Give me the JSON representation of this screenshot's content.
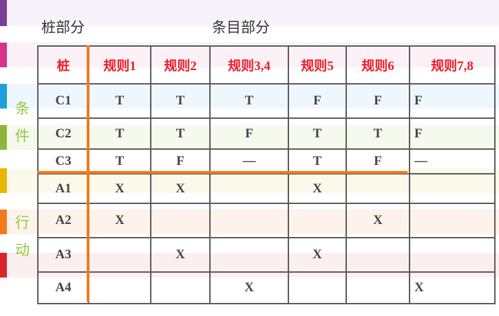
{
  "headers": {
    "stub_part": "桩部分",
    "entry_part": "条目部分"
  },
  "side_labels": {
    "conditions": [
      "条",
      "件"
    ],
    "actions": [
      "行",
      "动"
    ]
  },
  "columns": [
    "桩",
    "规则1",
    "规则2",
    "规则3,4",
    "规则5",
    "规则6",
    "规则7,8"
  ],
  "rows": [
    {
      "label": "C1",
      "cells": [
        "T",
        "T",
        "T",
        "F",
        "F",
        "F"
      ]
    },
    {
      "label": "C2",
      "cells": [
        "T",
        "T",
        "F",
        "T",
        "T",
        "F"
      ]
    },
    {
      "label": "C3",
      "cells": [
        "T",
        "F",
        "—",
        "T",
        "F",
        "—"
      ]
    },
    {
      "label": "A1",
      "cells": [
        "X",
        "X",
        "",
        "X",
        "",
        ""
      ]
    },
    {
      "label": "A2",
      "cells": [
        "X",
        "",
        "",
        "",
        "X",
        ""
      ]
    },
    {
      "label": "A3",
      "cells": [
        "",
        "X",
        "",
        "X",
        "",
        ""
      ]
    },
    {
      "label": "A4",
      "cells": [
        "",
        "",
        "X",
        "",
        "",
        "X"
      ]
    }
  ],
  "colors": {
    "title_red": "#ee1c25",
    "divider_orange": "#f07a1e",
    "side_green": "#92c83e",
    "border_gray": "#5b5b5b"
  }
}
